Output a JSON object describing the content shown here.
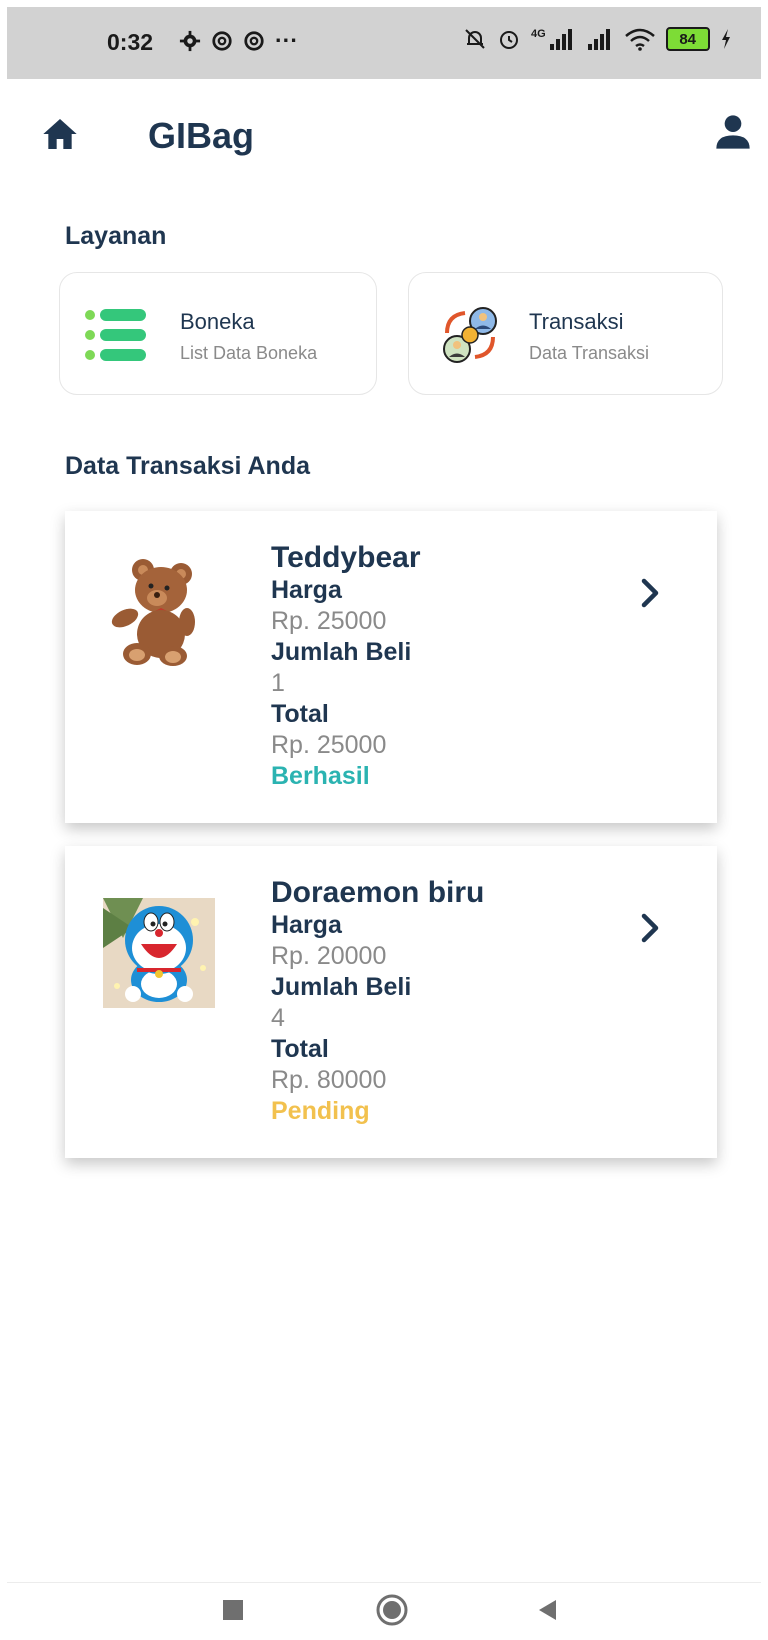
{
  "status_bar": {
    "time": "0:32",
    "left_icons": [
      "gear-icon",
      "at-icon",
      "at-icon",
      "more-dots-icon"
    ],
    "overflow_text": "···",
    "network_label": "4G",
    "battery_level": "84"
  },
  "app": {
    "title": "GIBag"
  },
  "services": {
    "title": "Layanan",
    "items": [
      {
        "title": "Boneka",
        "subtitle": "List Data Boneka",
        "icon": "list-icon"
      },
      {
        "title": "Transaksi",
        "subtitle": "Data Transaksi",
        "icon": "transaction-exchange-icon"
      }
    ]
  },
  "transactions": {
    "title": "Data Transaksi Anda",
    "labels": {
      "price": "Harga",
      "quantity": "Jumlah Beli",
      "total": "Total"
    },
    "items": [
      {
        "name": "Teddybear",
        "price": "Rp. 25000",
        "quantity": "1",
        "total": "Rp. 25000",
        "status": "Berhasil",
        "status_color": "#2bb3b1",
        "image": "teddybear-image"
      },
      {
        "name": "Doraemon biru",
        "price": "Rp. 20000",
        "quantity": "4",
        "total": "Rp. 80000",
        "status": "Pending",
        "status_color": "#f2c14e",
        "image": "doraemon-image"
      }
    ]
  },
  "colors": {
    "primary_text": "#1f3650",
    "muted_text": "#8a8a8a",
    "success": "#2bb3b1",
    "pending": "#f2c14e",
    "list_icon_green": "#34c77b"
  }
}
